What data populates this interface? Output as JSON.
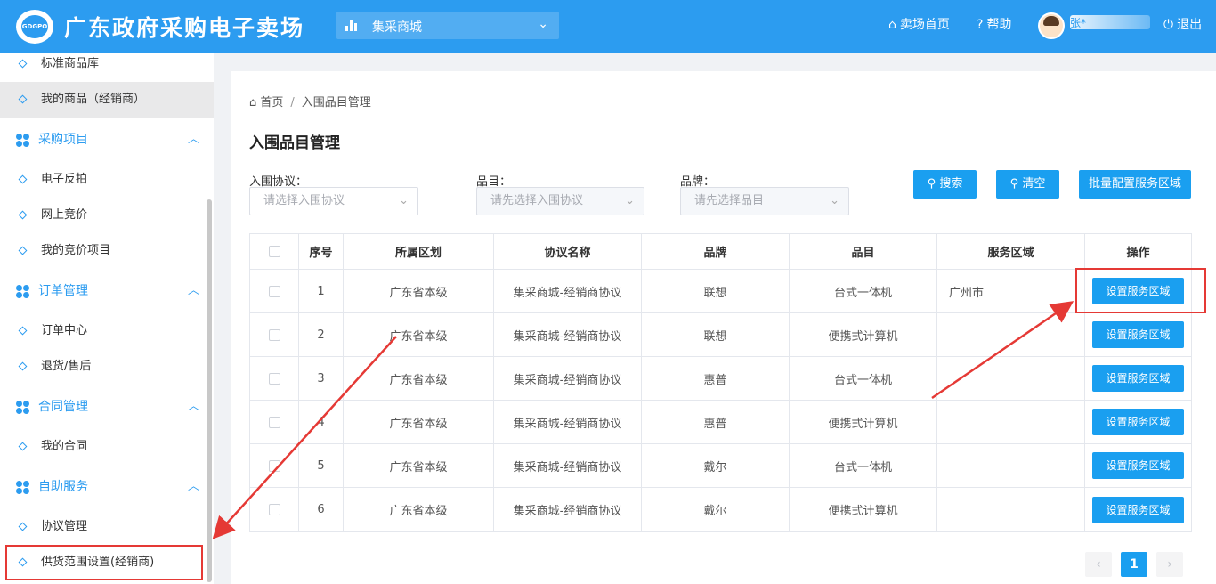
{
  "header": {
    "logo_text": "GDGPO",
    "title": "广东政府采购电子卖场",
    "mall_select": "集采商城",
    "home": "卖场首页",
    "help": "帮助",
    "username": "张*",
    "logout": "退出"
  },
  "sidebar": {
    "item_standard": "标准商品库",
    "item_my_goods": "我的商品（经销商）",
    "group_purchase": "采购项目",
    "item_reverse": "电子反拍",
    "item_online_bid": "网上竞价",
    "item_my_bid": "我的竞价项目",
    "group_orders": "订单管理",
    "item_order_center": "订单中心",
    "item_return": "退货/售后",
    "group_contract": "合同管理",
    "item_my_contract": "我的合同",
    "group_self": "自助服务",
    "item_agreement": "协议管理",
    "item_supply": "供货范围设置(经销商)"
  },
  "main": {
    "breadcrumb_home": "首页",
    "breadcrumb_current": "入围品目管理",
    "page_title": "入围品目管理",
    "filters": {
      "agreement_label": "入围协议：",
      "agreement_placeholder": "请选择入围协议",
      "category_label": "品目：",
      "category_placeholder": "请先选择入围协议",
      "brand_label": "品牌：",
      "brand_placeholder": "请先选择品目"
    },
    "buttons": {
      "search": "搜索",
      "clear": "清空",
      "batch": "批量配置服务区域"
    },
    "table": {
      "headers": [
        "序号",
        "所属区划",
        "协议名称",
        "品牌",
        "品目",
        "服务区域",
        "操作"
      ],
      "action_label": "设置服务区域",
      "rows": [
        {
          "no": "1",
          "region": "广东省本级",
          "agreement": "集采商城-经销商协议",
          "brand": "联想",
          "category": "台式一体机",
          "service": "广州市"
        },
        {
          "no": "2",
          "region": "广东省本级",
          "agreement": "集采商城-经销商协议",
          "brand": "联想",
          "category": "便携式计算机",
          "service": ""
        },
        {
          "no": "3",
          "region": "广东省本级",
          "agreement": "集采商城-经销商协议",
          "brand": "惠普",
          "category": "台式一体机",
          "service": ""
        },
        {
          "no": "4",
          "region": "广东省本级",
          "agreement": "集采商城-经销商协议",
          "brand": "惠普",
          "category": "便携式计算机",
          "service": ""
        },
        {
          "no": "5",
          "region": "广东省本级",
          "agreement": "集采商城-经销商协议",
          "brand": "戴尔",
          "category": "台式一体机",
          "service": ""
        },
        {
          "no": "6",
          "region": "广东省本级",
          "agreement": "集采商城-经销商协议",
          "brand": "戴尔",
          "category": "便携式计算机",
          "service": ""
        }
      ]
    },
    "pagination": {
      "prev": "‹",
      "current": "1",
      "next": "›"
    }
  },
  "colors": {
    "primary": "#2c9cf0",
    "button": "#1a9ff0",
    "annotation": "#e53935"
  }
}
